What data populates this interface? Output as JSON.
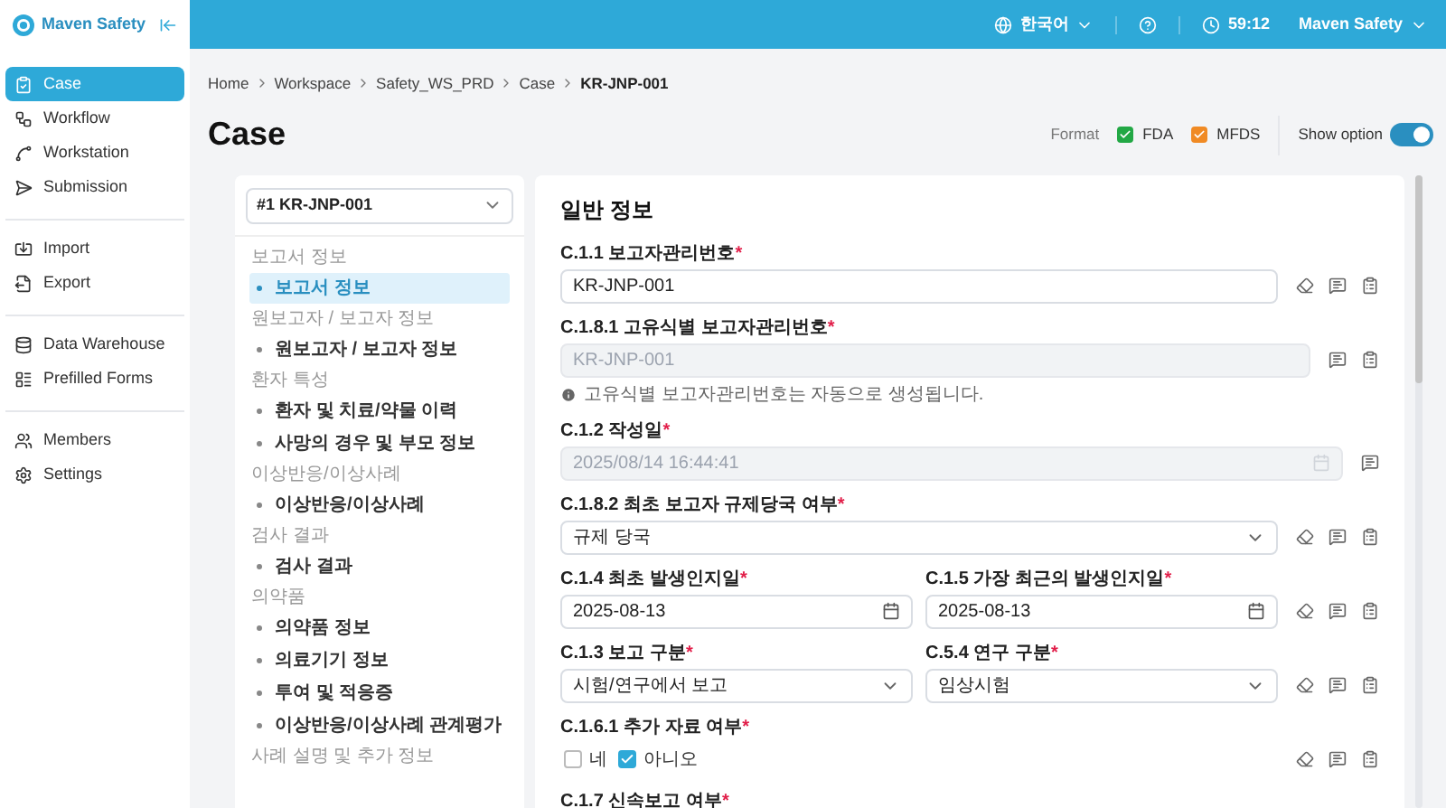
{
  "sidebar": {
    "brand": "Maven Safety",
    "groups": [
      [
        {
          "label": "Case",
          "selected": true
        },
        {
          "label": "Workflow",
          "selected": false
        },
        {
          "label": "Workstation",
          "selected": false
        },
        {
          "label": "Submission",
          "selected": false
        }
      ],
      [
        {
          "label": "Import",
          "selected": false
        },
        {
          "label": "Export",
          "selected": false
        }
      ],
      [
        {
          "label": "Data Warehouse",
          "selected": false
        },
        {
          "label": "Prefilled Forms",
          "selected": false
        }
      ],
      [
        {
          "label": "Members",
          "selected": false
        },
        {
          "label": "Settings",
          "selected": false
        }
      ]
    ]
  },
  "topbar": {
    "language": "한국어",
    "timer": "59:12",
    "user": "Maven Safety"
  },
  "breadcrumb": [
    "Home",
    "Workspace",
    "Safety_WS_PRD",
    "Case",
    "KR-JNP-001"
  ],
  "page_title": "Case",
  "format": {
    "label": "Format",
    "options": [
      {
        "label": "FDA",
        "checked": true,
        "color": "#22a845"
      },
      {
        "label": "MFDS",
        "checked": true,
        "color": "#f08a24"
      }
    ]
  },
  "show_option": {
    "label": "Show option",
    "on": true
  },
  "case_select": {
    "value": "#1 KR-JNP-001"
  },
  "sections": [
    {
      "title": "보고서 정보",
      "items": [
        {
          "label": "보고서 정보",
          "selected": true
        }
      ]
    },
    {
      "title": "원보고자 / 보고자 정보",
      "items": [
        {
          "label": "원보고자 / 보고자 정보",
          "selected": false
        }
      ]
    },
    {
      "title": "환자 특성",
      "items": [
        {
          "label": "환자 및 치료/약물 이력",
          "selected": false
        },
        {
          "label": "사망의 경우 및 부모 정보",
          "selected": false
        }
      ]
    },
    {
      "title": "이상반응/이상사례",
      "items": [
        {
          "label": "이상반응/이상사례",
          "selected": false
        }
      ]
    },
    {
      "title": "검사 결과",
      "items": [
        {
          "label": "검사 결과",
          "selected": false
        }
      ]
    },
    {
      "title": "의약품",
      "items": [
        {
          "label": "의약품 정보",
          "selected": false
        },
        {
          "label": "의료기기 정보",
          "selected": false
        },
        {
          "label": "투여 및 적응증",
          "selected": false
        },
        {
          "label": "이상반응/이상사례 관계평가",
          "selected": false
        }
      ]
    },
    {
      "title": "사례 설명 및 추가 정보"
    }
  ],
  "form": {
    "title": "일반 정보",
    "rows": [
      {
        "actions": [
          {
            "kind": "erase"
          },
          {
            "kind": "comment"
          },
          {
            "kind": "audit"
          }
        ],
        "fields": [
          {
            "kind": "text",
            "label": "C.1.1 보고자관리번호",
            "mark": "*",
            "value": "KR-JNP-001",
            "disabled": false
          }
        ]
      },
      {
        "actions": [
          {
            "kind": "comment"
          },
          {
            "kind": "audit"
          }
        ],
        "fields": [
          {
            "kind": "text",
            "label": "C.1.8.1 고유식별 보고자관리번호",
            "mark": "*",
            "value": "KR-JNP-001",
            "disabled": true,
            "hint": "고유식별 보고자관리번호는 자동으로 생성됩니다."
          }
        ]
      },
      {
        "actions": [
          {
            "kind": "comment"
          }
        ],
        "fields": [
          {
            "kind": "date",
            "label": "C.1.2 작성일",
            "mark": "*",
            "value": "2025/08/14 16:44:41",
            "disabled": true
          }
        ]
      },
      {
        "actions": [
          {
            "kind": "erase"
          },
          {
            "kind": "comment"
          },
          {
            "kind": "audit"
          }
        ],
        "fields": [
          {
            "kind": "select",
            "label": "C.1.8.2 최초 보고자 규제당국 여부",
            "mark": "*",
            "value": "규제 당국",
            "disabled": false
          }
        ]
      },
      {
        "actions": [
          {
            "kind": "erase"
          },
          {
            "kind": "comment"
          },
          {
            "kind": "audit"
          }
        ],
        "fields": [
          {
            "kind": "date",
            "label": "C.1.4 최초 발생인지일",
            "mark": "*",
            "value": "2025-08-13",
            "disabled": false
          },
          {
            "kind": "date",
            "label": "C.1.5 가장 최근의 발생인지일",
            "mark": "*",
            "value": "2025-08-13",
            "disabled": false
          }
        ]
      },
      {
        "actions": [
          {
            "kind": "erase"
          },
          {
            "kind": "comment"
          },
          {
            "kind": "audit"
          }
        ],
        "fields": [
          {
            "kind": "select",
            "label": "C.1.3 보고 구분",
            "mark": "*",
            "value": "시험/연구에서 보고",
            "disabled": false
          },
          {
            "kind": "select",
            "label": "C.5.4 연구 구분",
            "mark": "*",
            "value": "임상시험",
            "disabled": false
          }
        ]
      },
      {
        "actions": [
          {
            "kind": "erase"
          },
          {
            "kind": "comment"
          },
          {
            "kind": "audit"
          }
        ],
        "fields": [
          {
            "kind": "checks",
            "label": "C.1.6.1 추가 자료 여부",
            "mark": "*",
            "options": [
              {
                "label": "네",
                "checked": false
              },
              {
                "label": "아니오",
                "checked": true
              }
            ]
          }
        ]
      },
      {
        "fields": [
          {
            "kind": "label",
            "label": "C.1.7 신속보고 여부",
            "mark": "*"
          }
        ]
      }
    ]
  }
}
